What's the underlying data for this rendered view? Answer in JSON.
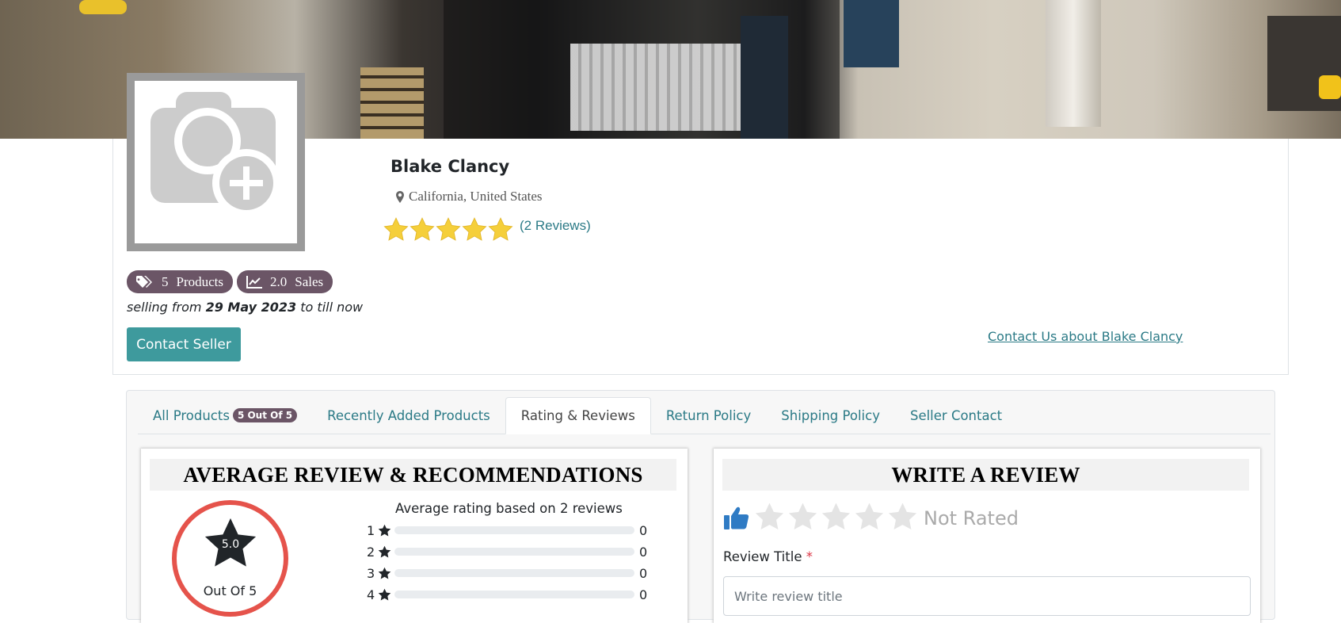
{
  "seller": {
    "name": "Blake Clancy",
    "location": "California, United States",
    "reviews_link": "(2 Reviews)",
    "rating": 5,
    "products_count": "5",
    "products_label": "Products",
    "sales_count": "2.0",
    "sales_label": "Sales",
    "since_prefix": "selling from",
    "since_date": "29 May 2023",
    "since_suffix": "to till now",
    "contact_button": "Contact Seller",
    "contact_us_link": "Contact Us about Blake Clancy"
  },
  "tabs": [
    {
      "label": "All Products",
      "pill": "5 Out Of 5"
    },
    {
      "label": "Recently Added Products"
    },
    {
      "label": "Rating & Reviews",
      "active": true
    },
    {
      "label": "Return Policy"
    },
    {
      "label": "Shipping Policy"
    },
    {
      "label": "Seller Contact"
    }
  ],
  "average_review": {
    "heading": "AVERAGE REVIEW & RECOMMENDATIONS",
    "score": "5.0",
    "out_of": "Out Of 5",
    "based_on": "Average rating based on 2 reviews",
    "rows": [
      {
        "stars": "1",
        "count": "0",
        "fraction": 0
      },
      {
        "stars": "2",
        "count": "0",
        "fraction": 0
      },
      {
        "stars": "3",
        "count": "0",
        "fraction": 0
      },
      {
        "stars": "4",
        "count": "0",
        "fraction": 0
      }
    ]
  },
  "write_review": {
    "heading": "WRITE A REVIEW",
    "status": "Not Rated",
    "title_label": "Review Title",
    "required_mark": "*",
    "title_placeholder": "Write review title"
  },
  "colors": {
    "accent": "#3e9a9d",
    "link": "#2b7a86",
    "badge": "#6b5566",
    "star_gold": "#f5cf3a",
    "circle_red": "#e5534b"
  },
  "icons": {
    "location": "map-marker-icon",
    "products": "tags-icon",
    "sales": "line-chart-icon",
    "thumb": "thumbs-up-icon",
    "star": "star-icon"
  }
}
